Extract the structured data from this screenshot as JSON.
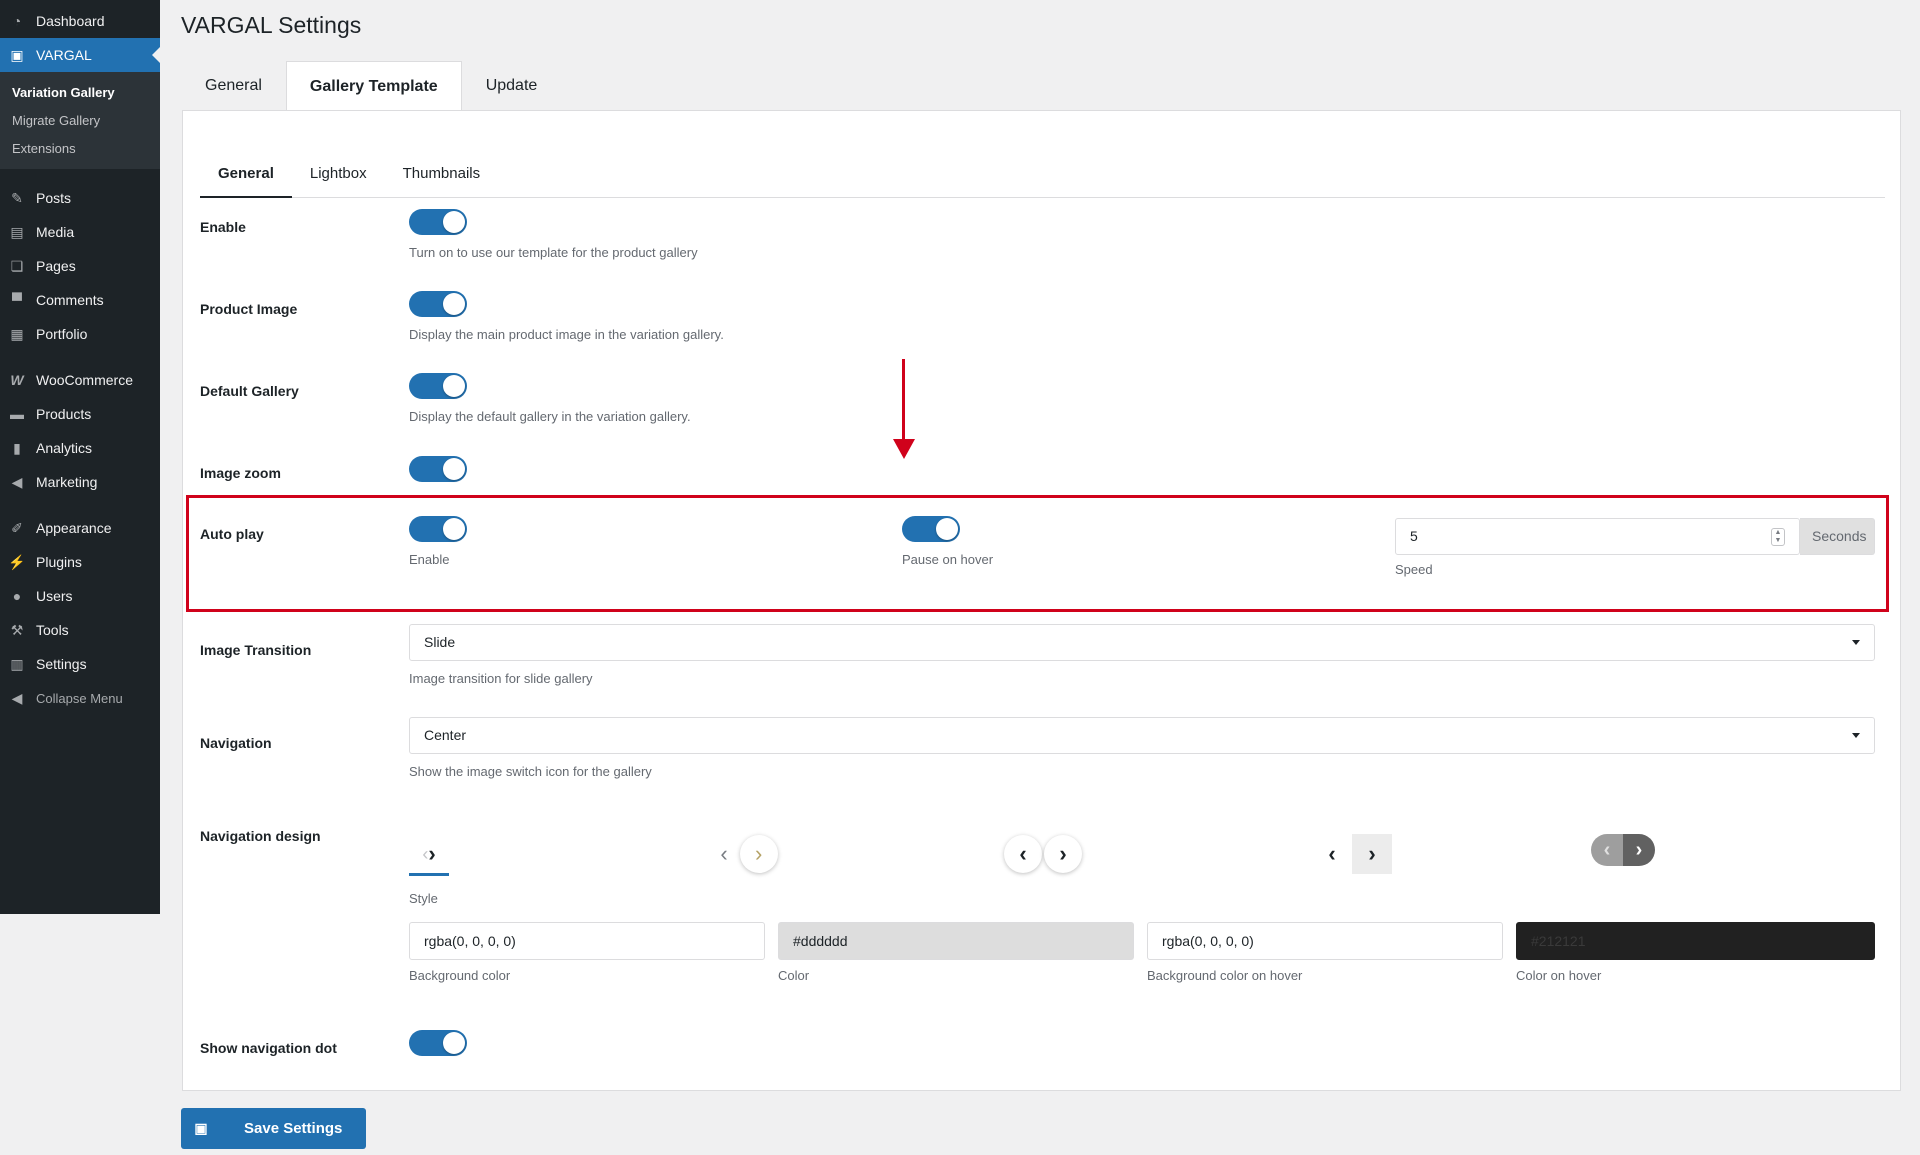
{
  "sidebar": {
    "top_items": [
      {
        "label": "Dashboard",
        "icon": "dashboard-icon"
      },
      {
        "label": "VARGAL",
        "icon": "vargal-icon",
        "active": true
      }
    ],
    "submenu": [
      {
        "label": "Variation Gallery",
        "current": true
      },
      {
        "label": "Migrate Gallery"
      },
      {
        "label": "Extensions"
      }
    ],
    "items_a": [
      {
        "label": "Posts",
        "icon": "pin-icon"
      },
      {
        "label": "Media",
        "icon": "media-icon"
      },
      {
        "label": "Pages",
        "icon": "pages-icon"
      },
      {
        "label": "Comments",
        "icon": "comment-icon"
      },
      {
        "label": "Portfolio",
        "icon": "grid-icon"
      }
    ],
    "items_b": [
      {
        "label": "WooCommerce",
        "icon": "woo-icon"
      },
      {
        "label": "Products",
        "icon": "archive-icon"
      },
      {
        "label": "Analytics",
        "icon": "bar-chart-icon"
      },
      {
        "label": "Marketing",
        "icon": "megaphone-icon"
      }
    ],
    "items_c": [
      {
        "label": "Appearance",
        "icon": "brush-icon"
      },
      {
        "label": "Plugins",
        "icon": "plug-icon"
      },
      {
        "label": "Users",
        "icon": "user-icon"
      },
      {
        "label": "Tools",
        "icon": "wrench-icon"
      },
      {
        "label": "Settings",
        "icon": "settings-icon"
      }
    ],
    "collapse_label": "Collapse Menu"
  },
  "page": {
    "title": "VARGAL Settings",
    "tabs": [
      "General",
      "Gallery Template",
      "Update"
    ],
    "active_tab": "Gallery Template",
    "inner_tabs": [
      "General",
      "Lightbox",
      "Thumbnails"
    ]
  },
  "settings": {
    "enable": {
      "label": "Enable",
      "on": true,
      "desc": "Turn on to use our template for the product gallery"
    },
    "product_image": {
      "label": "Product Image",
      "on": true,
      "desc": "Display the main product image in the variation gallery."
    },
    "default_gallery": {
      "label": "Default Gallery",
      "on": true,
      "desc": "Display the default gallery in the variation gallery."
    },
    "image_zoom": {
      "label": "Image zoom",
      "on": true
    },
    "auto_play": {
      "label": "Auto play",
      "enable_label": "Enable",
      "pause_label": "Pause on hover",
      "speed_value": "5",
      "speed_unit": "Seconds",
      "speed_label": "Speed"
    },
    "image_transition": {
      "label": "Image Transition",
      "value": "Slide",
      "desc": "Image transition for slide gallery"
    },
    "navigation": {
      "label": "Navigation",
      "value": "Center",
      "desc": "Show the image switch icon for the gallery"
    },
    "navigation_design": {
      "label": "Navigation design",
      "style_label": "Style",
      "colors": [
        {
          "value": "rgba(0, 0, 0, 0)",
          "label": "Background color",
          "bg": "#ffffff",
          "fg": "#1d2327"
        },
        {
          "value": "#dddddd",
          "label": "Color",
          "bg": "#dddddd",
          "fg": "#1d2327"
        },
        {
          "value": "rgba(0, 0, 0, 0)",
          "label": "Background color on hover",
          "bg": "#ffffff",
          "fg": "#1d2327"
        },
        {
          "value": "#212121",
          "label": "Color on hover",
          "bg": "#212121",
          "fg": "#3a3a3a"
        }
      ]
    },
    "show_nav_dot": {
      "label": "Show navigation dot",
      "on": true
    }
  },
  "save_label": "Save Settings",
  "colors": {
    "accent": "#2271b1",
    "highlight": "#d0021b",
    "sidebar": "#1d2327"
  }
}
